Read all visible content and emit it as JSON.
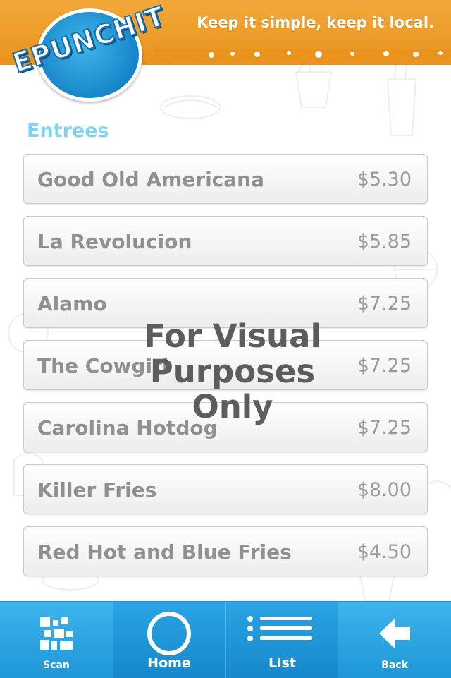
{
  "header": {
    "logo_text": "EPUNCHIT",
    "tagline": "Keep it simple, keep it local."
  },
  "section": {
    "title": "Entrees"
  },
  "menu_items": [
    {
      "name": "Good Old Americana",
      "price": "$5.30"
    },
    {
      "name": "La Revolucion",
      "price": "$5.85"
    },
    {
      "name": "Alamo",
      "price": "$7.25"
    },
    {
      "name": "The Cowgirl",
      "price": "$7.25"
    },
    {
      "name": "Carolina Hotdog",
      "price": "$7.25"
    },
    {
      "name": "Killer Fries",
      "price": "$8.00"
    },
    {
      "name": "Red Hot and Blue Fries",
      "price": "$4.50"
    }
  ],
  "watermark": {
    "line1": "For Visual",
    "line2": "Purposes",
    "line3": "Only"
  },
  "tabbar": {
    "tabs": [
      {
        "label": "Scan",
        "icon": "qr-code-icon"
      },
      {
        "label": "Home",
        "icon": "circle-home-icon"
      },
      {
        "label": "List",
        "icon": "list-icon"
      },
      {
        "label": "Back",
        "icon": "back-arrow-icon"
      }
    ]
  },
  "colors": {
    "header_orange": "#e9931c",
    "accent_blue": "#2aa4e3",
    "section_title": "#7fd2f1"
  }
}
